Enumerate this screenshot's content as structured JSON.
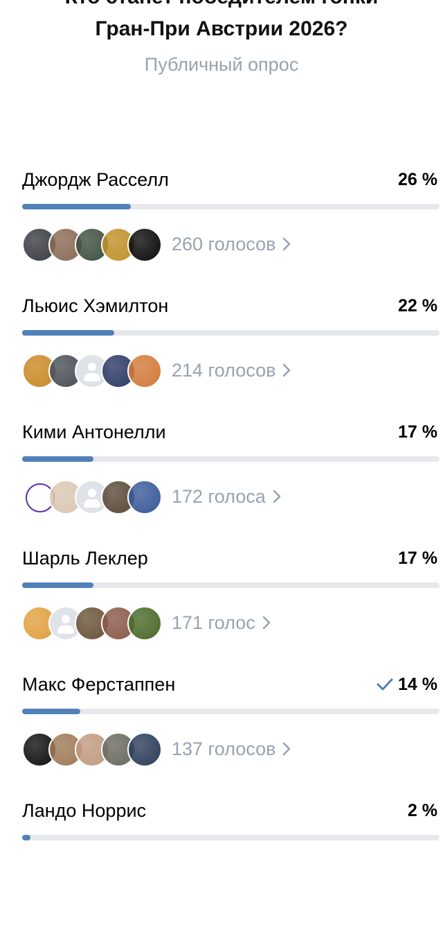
{
  "poll": {
    "title_line1": "Кто станет победителем гонки",
    "title_line2": "Гран-При Австрии 2026?",
    "type_label": "Публичный опрос"
  },
  "options": [
    {
      "name": "Джордж Расселл",
      "percent_label": "26 %",
      "percent": 26,
      "votes_label": "260 голосов",
      "avatars": [
        {
          "icon": "avatar-photo",
          "color": "#3a3d42"
        },
        {
          "icon": "avatar-photo",
          "color": "#8a6a55"
        },
        {
          "icon": "avatar-photo",
          "color": "#3f5040"
        },
        {
          "icon": "avatar-photo",
          "color": "#c0902a"
        },
        {
          "icon": "avatar-photo",
          "color": "#0c0c0c"
        }
      ]
    },
    {
      "name": "Льюис Хэмилтон",
      "percent_label": "22 %",
      "percent": 22,
      "votes_label": "214 голосов",
      "avatars": [
        {
          "icon": "avatar-photo",
          "color": "#c98a25"
        },
        {
          "icon": "avatar-photo",
          "color": "#4a4f57"
        },
        {
          "icon": "avatar-placeholder",
          "color": "#dfe3e8"
        },
        {
          "icon": "avatar-photo",
          "color": "#2c3a66"
        },
        {
          "icon": "avatar-photo",
          "color": "#d27a3a"
        }
      ]
    },
    {
      "name": "Кими Антонелли",
      "percent_label": "17 %",
      "percent": 17,
      "votes_label": "172 голоса",
      "avatars": [
        {
          "icon": "vk-logo",
          "color": "#5b2ca8"
        },
        {
          "icon": "avatar-photo",
          "color": "#d9c7b2"
        },
        {
          "icon": "avatar-placeholder",
          "color": "#dfe3e8"
        },
        {
          "icon": "avatar-photo",
          "color": "#5a4a38"
        },
        {
          "icon": "avatar-photo",
          "color": "#3a5a9a"
        }
      ]
    },
    {
      "name": "Шарль Леклер",
      "percent_label": "17 %",
      "percent": 17,
      "votes_label": "171 голос",
      "avatars": [
        {
          "icon": "avatar-photo",
          "color": "#e0a040"
        },
        {
          "icon": "avatar-placeholder",
          "color": "#dfe3e8"
        },
        {
          "icon": "avatar-photo",
          "color": "#6a5438"
        },
        {
          "icon": "avatar-photo",
          "color": "#8a5a4a"
        },
        {
          "icon": "avatar-photo",
          "color": "#4a6a2a"
        }
      ]
    },
    {
      "name": "Макс Ферстаппен",
      "percent_label": "14 %",
      "percent": 14,
      "votes_label": "137 голосов",
      "voted": true,
      "avatars": [
        {
          "icon": "avatar-photo",
          "color": "#111111"
        },
        {
          "icon": "avatar-photo",
          "color": "#a07a58"
        },
        {
          "icon": "avatar-photo",
          "color": "#c09a80"
        },
        {
          "icon": "avatar-photo",
          "color": "#6a6a60"
        },
        {
          "icon": "avatar-photo",
          "color": "#2c3e5a"
        }
      ]
    },
    {
      "name": "Ландо Норрис",
      "percent_label": "2 %",
      "percent": 2,
      "votes_label": "",
      "avatars": []
    }
  ],
  "colors": {
    "accent": "#5181b8",
    "track": "#e7e8ec",
    "secondary_text": "#99a2ad"
  }
}
